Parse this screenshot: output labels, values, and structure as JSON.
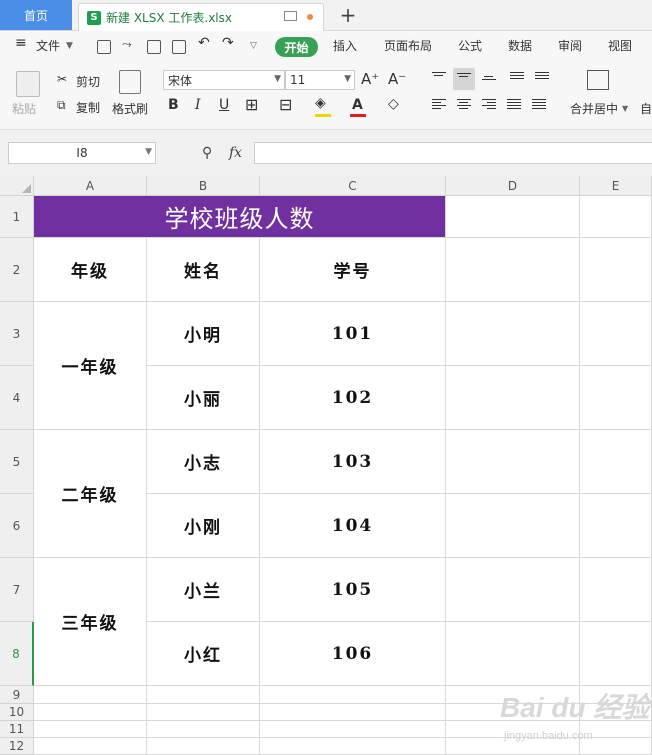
{
  "tabbar": {
    "home_label": "首页",
    "doc_icon_letter": "S",
    "doc_name": "新建 XLSX 工作表.xlsx",
    "new_tab": "+"
  },
  "menubar": {
    "file": "文件",
    "items": [
      "开始",
      "插入",
      "页面布局",
      "公式",
      "数据",
      "审阅",
      "视图"
    ]
  },
  "ribbon": {
    "paste": "粘贴",
    "cut": "剪切",
    "copy": "复制",
    "format_painter": "格式刷",
    "font_name": "宋体",
    "font_size": "11",
    "font_grow": "A⁺",
    "font_shrink": "A⁻",
    "bold": "B",
    "italic": "I",
    "underline": "U",
    "merge_center": "合并居中",
    "auto_wrap_partial": "自"
  },
  "formula_bar": {
    "cell_ref": "I8",
    "fx": "fx",
    "value": ""
  },
  "sheet": {
    "columns": [
      "A",
      "B",
      "C",
      "D",
      "E"
    ],
    "rows": [
      "1",
      "2",
      "3",
      "4",
      "5",
      "6",
      "7",
      "8",
      "9",
      "10",
      "11",
      "12"
    ],
    "active_row": "8",
    "title": "学校班级人数",
    "headers": [
      "年级",
      "姓名",
      "学号"
    ],
    "grades": [
      "一年级",
      "二年级",
      "三年级"
    ],
    "names": [
      "小明",
      "小丽",
      "小志",
      "小刚",
      "小兰",
      "小红"
    ],
    "ids": [
      "101",
      "102",
      "103",
      "104",
      "105",
      "106"
    ]
  },
  "watermark": {
    "text": "Bai du 经验",
    "sub": "jingyan.baidu.com"
  },
  "colors": {
    "title_fill": "#7030a0",
    "start_tab": "#38a155",
    "home_tab": "#4a8ee8",
    "active_row": "#2f9a45"
  }
}
